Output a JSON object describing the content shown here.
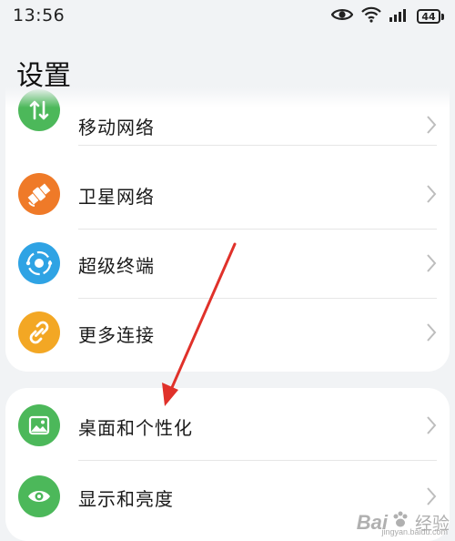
{
  "status_bar": {
    "time": "13:56",
    "battery": "44",
    "icons": [
      "eye-icon",
      "wifi-icon",
      "signal-icon",
      "battery-icon"
    ]
  },
  "page": {
    "title": "设置"
  },
  "group_1": [
    {
      "label": "移动网络",
      "icon": "mobile-data-icon",
      "color": "#4cb85a"
    },
    {
      "label": "卫星网络",
      "icon": "satellite-icon",
      "color": "#ef7a28"
    },
    {
      "label": "超级终端",
      "icon": "super-device-icon",
      "color": "#2fa3e4"
    },
    {
      "label": "更多连接",
      "icon": "link-icon",
      "color": "#f3a724"
    }
  ],
  "group_2": [
    {
      "label": "桌面和个性化",
      "icon": "wallpaper-icon",
      "color": "#4cb85a"
    },
    {
      "label": "显示和亮度",
      "icon": "eye-icon",
      "color": "#4cb85a"
    }
  ],
  "watermark": {
    "logo": "Bai",
    "text": "经验",
    "url": "jingyan.baidu.com"
  },
  "annotation": {
    "arrow_color": "#e0312a"
  }
}
